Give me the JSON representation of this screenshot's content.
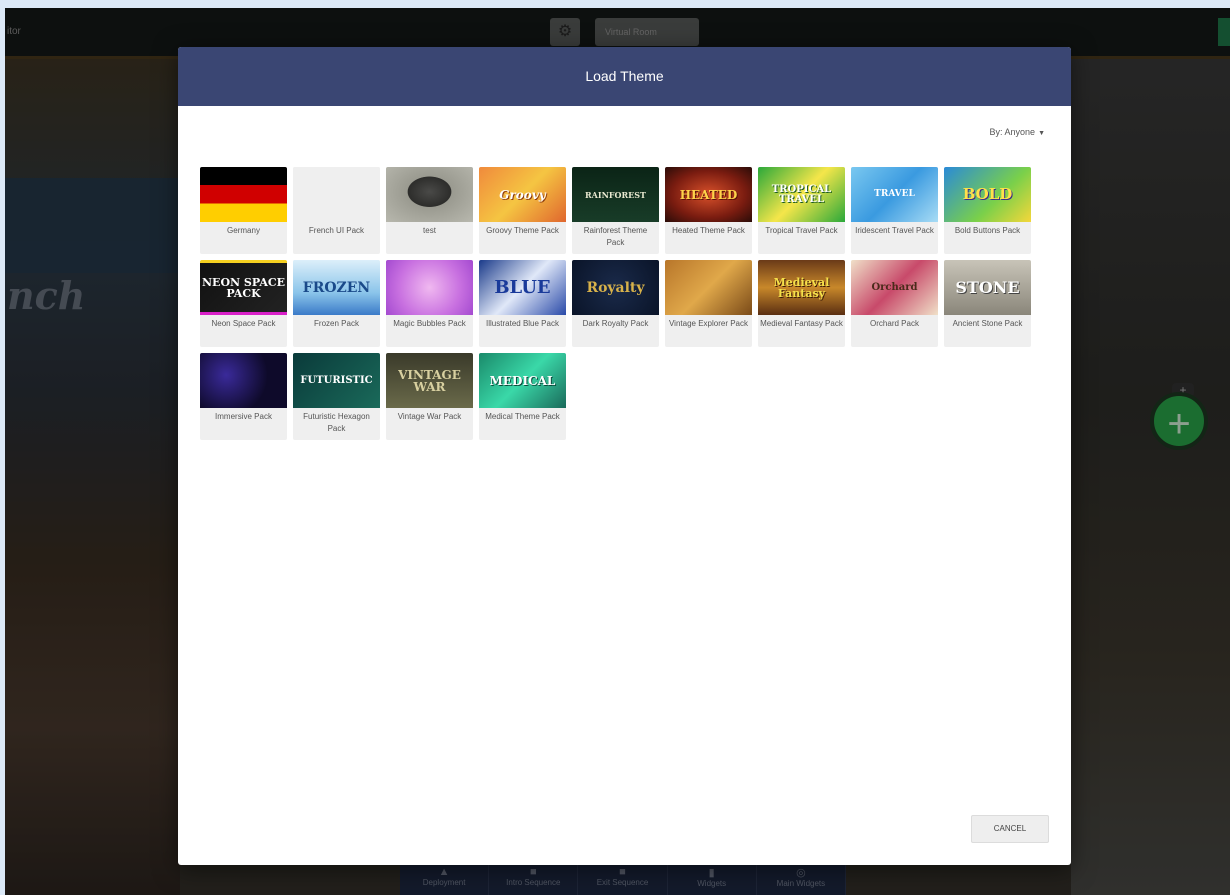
{
  "app": {
    "title": "itor",
    "gear_icon": "gear-icon",
    "room_select": "Virtual Room",
    "background_text": "nch",
    "add_button": "+",
    "bottom_bar": [
      "Deployment",
      "Intro Sequence",
      "Exit Sequence",
      "Widgets",
      "Main Widgets"
    ]
  },
  "modal": {
    "title": "Load Theme",
    "filter_label": "By: Anyone",
    "cancel_label": "CANCEL",
    "themes": [
      {
        "label": "Germany",
        "thumb_text": ""
      },
      {
        "label": "French UI Pack",
        "thumb_text": ""
      },
      {
        "label": "test",
        "thumb_text": ""
      },
      {
        "label": "Groovy Theme Pack",
        "thumb_text": "Groovy"
      },
      {
        "label": "Rainforest Theme Pack",
        "thumb_text": "RAINFOREST"
      },
      {
        "label": "Heated Theme Pack",
        "thumb_text": "HEATED"
      },
      {
        "label": "Tropical Travel Pack",
        "thumb_text": "TROPICAL TRAVEL"
      },
      {
        "label": "Iridescent Travel Pack",
        "thumb_text": "TRAVEL"
      },
      {
        "label": "Bold Buttons Pack",
        "thumb_text": "BOLD"
      },
      {
        "label": "Neon Space Pack",
        "thumb_text": "NEON SPACE PACK"
      },
      {
        "label": "Frozen Pack",
        "thumb_text": "FROZEN"
      },
      {
        "label": "Magic Bubbles Pack",
        "thumb_text": ""
      },
      {
        "label": "Illustrated Blue Pack",
        "thumb_text": "BLUE"
      },
      {
        "label": "Dark Royalty Pack",
        "thumb_text": "Royalty"
      },
      {
        "label": "Vintage Explorer Pack",
        "thumb_text": ""
      },
      {
        "label": "Medieval Fantasy Pack",
        "thumb_text": "Medieval Fantasy"
      },
      {
        "label": "Orchard Pack",
        "thumb_text": "Orchard"
      },
      {
        "label": "Ancient Stone Pack",
        "thumb_text": "STONE"
      },
      {
        "label": "Immersive Pack",
        "thumb_text": ""
      },
      {
        "label": "Futuristic Hexagon Pack",
        "thumb_text": "FUTURISTIC"
      },
      {
        "label": "Vintage War Pack",
        "thumb_text": "VINTAGE WAR"
      },
      {
        "label": "Medical Theme Pack",
        "thumb_text": "MEDICAL"
      }
    ]
  }
}
